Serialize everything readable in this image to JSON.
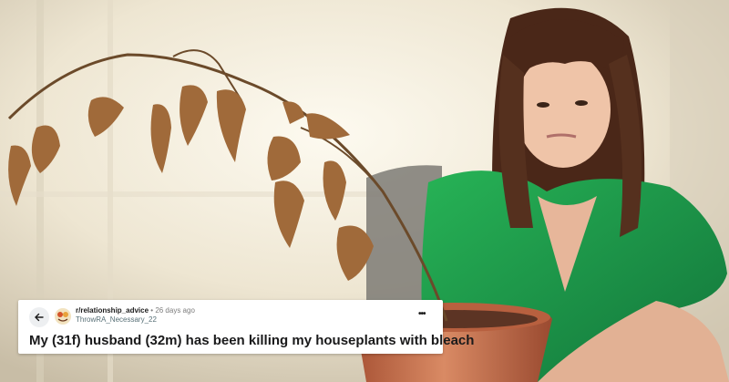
{
  "post": {
    "subreddit": "r/relationship_advice",
    "separator": "•",
    "age": "26 days ago",
    "username": "ThrowRA_Necessary_22",
    "title": "My (31f) husband (32m) has been killing my houseplants with bleach",
    "menu_icon": "more-horizontal-icon",
    "back_icon": "arrow-left-icon"
  },
  "colors": {
    "card_bg": "#ffffff",
    "shirt": "#1e9a48",
    "pot": "#c76a4a"
  }
}
